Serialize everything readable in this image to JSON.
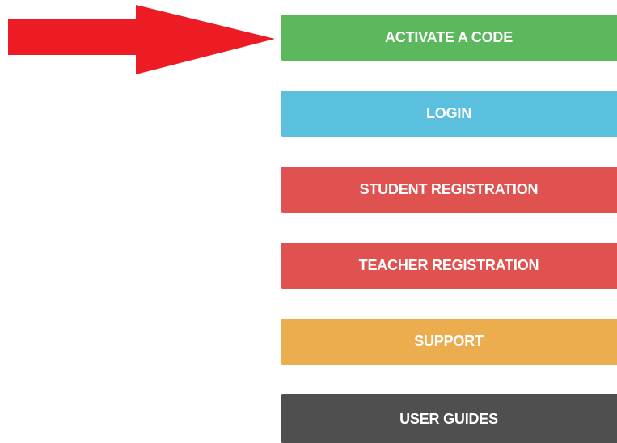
{
  "annotation": {
    "arrow_color": "#ed1c24",
    "arrow_target": "activate-code-button"
  },
  "menu": {
    "buttons": [
      {
        "key": "activate",
        "label": "ACTIVATE A CODE",
        "color": "#5cb85c"
      },
      {
        "key": "login",
        "label": "LOGIN",
        "color": "#5bc0de"
      },
      {
        "key": "student",
        "label": "STUDENT REGISTRATION",
        "color": "#e0524f"
      },
      {
        "key": "teacher",
        "label": "TEACHER REGISTRATION",
        "color": "#e0524f"
      },
      {
        "key": "support",
        "label": "SUPPORT",
        "color": "#ecad4e"
      },
      {
        "key": "guides",
        "label": "USER GUIDES",
        "color": "#4f4f4f"
      }
    ]
  }
}
